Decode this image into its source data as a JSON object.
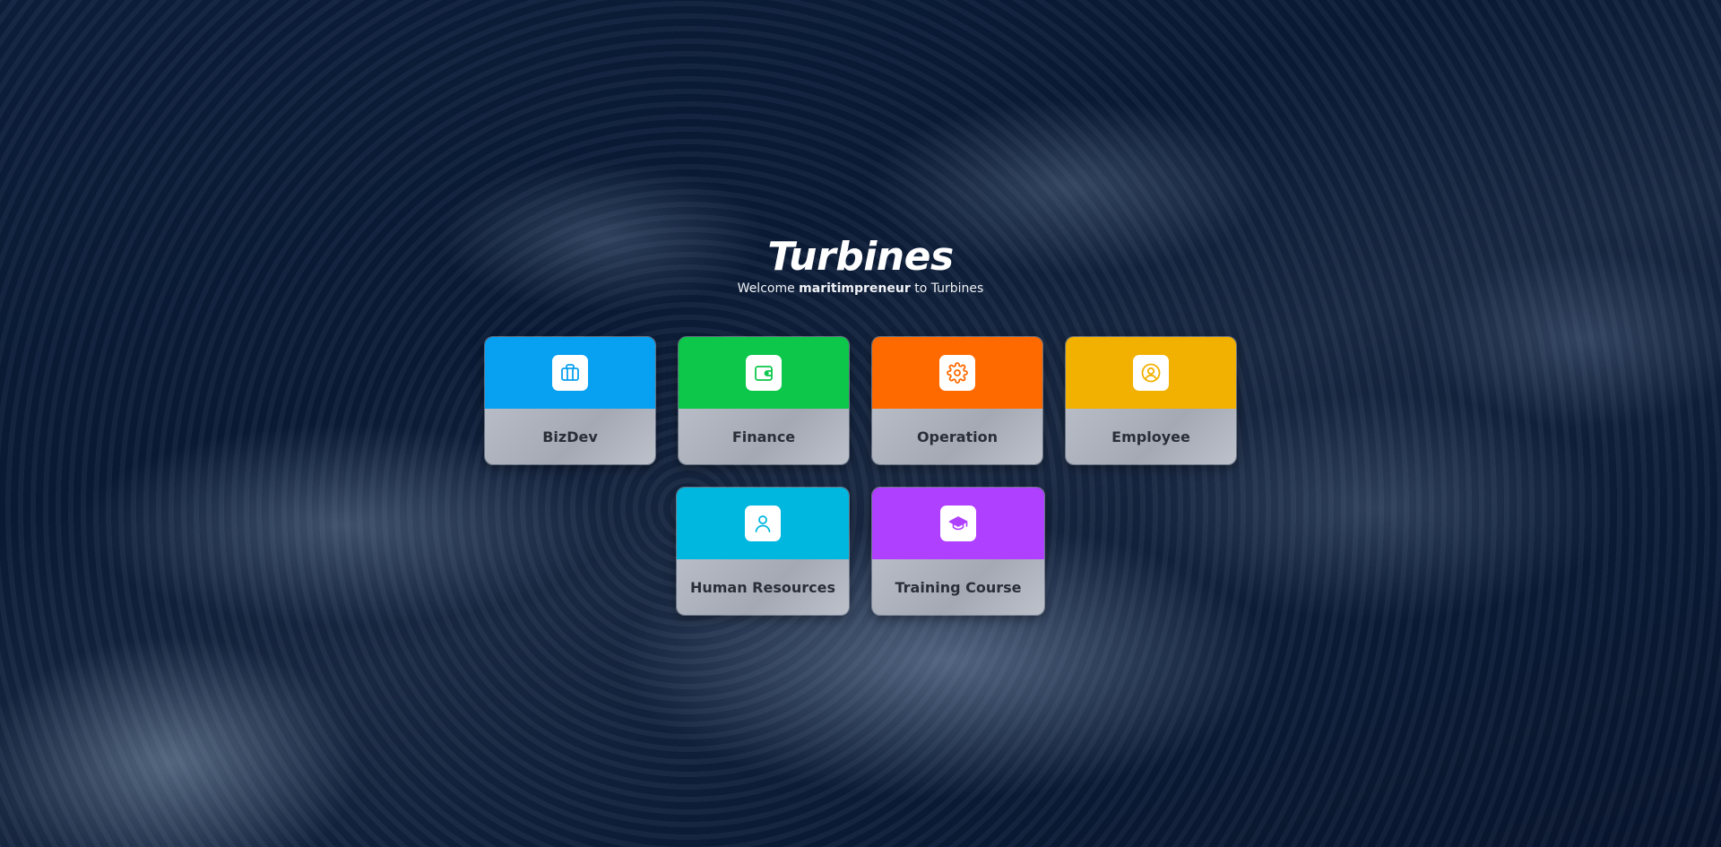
{
  "header": {
    "title": "Turbines",
    "subtitle_prefix": "Welcome ",
    "subtitle_user": "maritimpreneur",
    "subtitle_suffix": " to Turbines"
  },
  "cards": [
    {
      "label": "BizDev",
      "icon": "briefcase-icon",
      "color": "#08a0f0"
    },
    {
      "label": "Finance",
      "icon": "wallet-icon",
      "color": "#0cc74a"
    },
    {
      "label": "Operation",
      "icon": "gear-icon",
      "color": "#ff6a00"
    },
    {
      "label": "Employee",
      "icon": "user-circle-icon",
      "color": "#f2b000"
    },
    {
      "label": "Human Resources",
      "icon": "user-icon",
      "color": "#00b7e0"
    },
    {
      "label": "Training Course",
      "icon": "graduation-cap-icon",
      "color": "#b040ff"
    }
  ]
}
